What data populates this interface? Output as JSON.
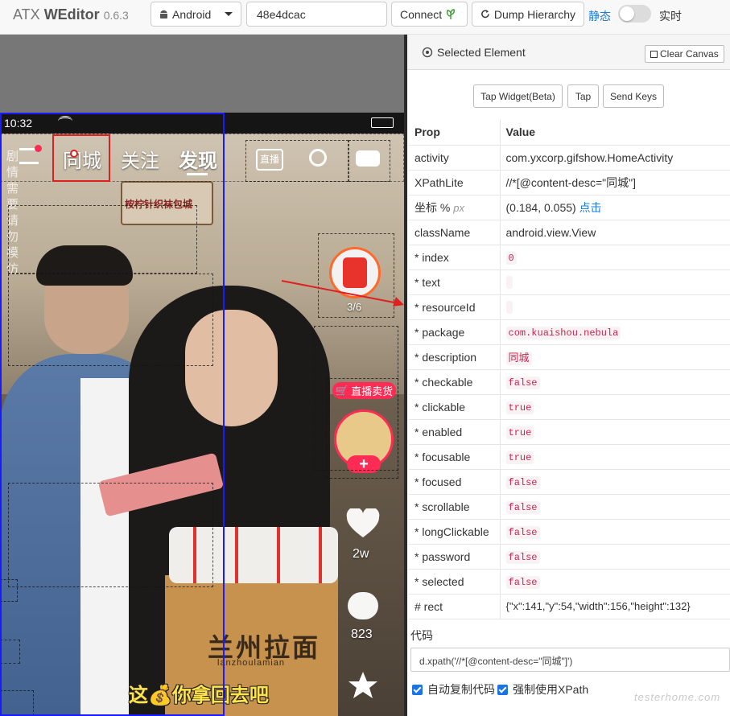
{
  "app": {
    "name_light": "ATX",
    "name_bold": "WEditor",
    "version": "0.6.3"
  },
  "toolbar": {
    "platform": "Android",
    "serial": "48e4dcac",
    "connect_label": "Connect",
    "dump_label": "Dump Hierarchy",
    "mode_static": "静态",
    "mode_live": "实时"
  },
  "device": {
    "clock": "10:32",
    "tabs": [
      "同城",
      "关注",
      "发现"
    ],
    "live_label": "直播",
    "side_text": "剧情需要请勿模仿",
    "red_packet_count": "3/6",
    "live_selling_badge": "直播卖货",
    "like_count": "2w",
    "comment_count": "823",
    "subtitle": "这💰你拿回去吧",
    "sign_text": "兰州拉面",
    "sign_sub": "lanzhoulamian",
    "banner_text": "桉柠针织袜包城"
  },
  "panel": {
    "title": "Selected Element",
    "clear_canvas": "Clear Canvas",
    "buttons": [
      "Tap Widget(Beta)",
      "Tap",
      "Send Keys"
    ],
    "col_prop": "Prop",
    "col_value": "Value",
    "props": {
      "activity": "com.yxcorp.gifshow.HomeActivity",
      "xpathlite": "//*[@content-desc=\"同城\"]",
      "coord_label": "坐标 %",
      "coord_unit": "px",
      "coord_value": "(0.184, 0.055)",
      "coord_click": "点击",
      "classname": "android.view.View",
      "index": "0",
      "text": "",
      "resourceid": "",
      "package": "com.kuaishou.nebula",
      "description": "同城",
      "checkable": "false",
      "clickable": "true",
      "enabled": "true",
      "focusable": "true",
      "focused": "false",
      "scrollable": "false",
      "longclickable": "false",
      "password": "false",
      "selected": "false",
      "rect": "{\"x\":141,\"y\":54,\"width\":156,\"height\":132}"
    },
    "keys": {
      "activity": "activity",
      "xpathlite": "XPathLite",
      "classname": "className",
      "index": "* index",
      "text": "* text",
      "resourceid": "* resourceId",
      "package": "* package",
      "description": "* description",
      "checkable": "* checkable",
      "clickable": "* clickable",
      "enabled": "* enabled",
      "focusable": "* focusable",
      "focused": "* focused",
      "scrollable": "* scrollable",
      "longclickable": "* longClickable",
      "password": "* password",
      "selected": "* selected",
      "rect": "# rect"
    },
    "code_label": "代码",
    "code": "d.xpath('//*[@content-desc=\"同城\"]')",
    "auto_copy": "自动复制代码",
    "force_xpath": "强制使用XPath",
    "watermark": "testerhome.com"
  },
  "colors": {
    "accent": "#1c7cd6",
    "highlight_red": "#e02020",
    "select_blue": "#1a1aff",
    "kuaishou_red": "#fe2c55"
  }
}
